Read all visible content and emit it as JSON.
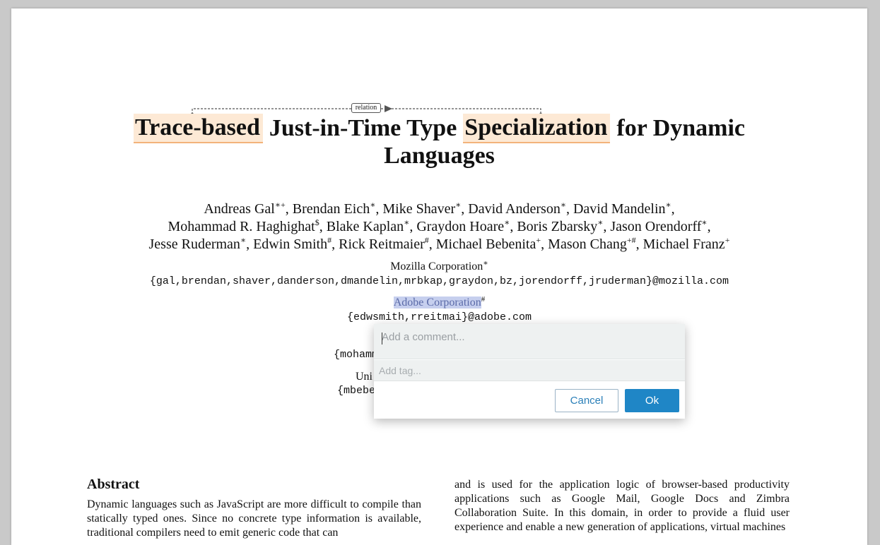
{
  "paper": {
    "title_part1": "Trace-based",
    "title_part2": "Just-in-Time Type",
    "title_part3": "Specialization",
    "title_part4": "for Dynamic",
    "title_line2": "Languages",
    "relation_label": "relation",
    "authors": {
      "line1": [
        {
          "name": "Andreas Gal",
          "mark": "∗+"
        },
        {
          "name": ", Brendan Eich",
          "mark": "∗"
        },
        {
          "name": ", Mike Shaver",
          "mark": "∗"
        },
        {
          "name": ", David Anderson",
          "mark": "∗"
        },
        {
          "name": ", David Mandelin",
          "mark": "∗"
        },
        {
          "name": ",",
          "mark": ""
        }
      ],
      "line2": [
        {
          "name": "Mohammad R. Haghighat",
          "mark": "$"
        },
        {
          "name": ", Blake Kaplan",
          "mark": "∗"
        },
        {
          "name": ", Graydon Hoare",
          "mark": "∗"
        },
        {
          "name": ", Boris Zbarsky",
          "mark": "∗"
        },
        {
          "name": ", Jason Orendorff",
          "mark": "∗"
        },
        {
          "name": ",",
          "mark": ""
        }
      ],
      "line3": [
        {
          "name": "Jesse Ruderman",
          "mark": "∗"
        },
        {
          "name": ", Edwin Smith",
          "mark": "#"
        },
        {
          "name": ", Rick Reitmaier",
          "mark": "#"
        },
        {
          "name": ", Michael Bebenita",
          "mark": "+"
        },
        {
          "name": ", Mason Chang",
          "mark": "+#"
        },
        {
          "name": ", Michael Franz",
          "mark": "+"
        }
      ]
    },
    "affiliation1": {
      "name": "Mozilla Corporation",
      "mark": "∗"
    },
    "emails1": "{gal,brendan,shaver,danderson,dmandelin,mrbkap,graydon,bz,jorendorff,jruderman}@mozilla.com",
    "affiliation2": {
      "name": "Adobe Corporation",
      "mark": "#"
    },
    "emails2": "{edwsmith,rreitmai}@adobe.com",
    "emails3_partial": "{mohamm",
    "affiliation4_partial": "Uni",
    "emails4_partial": "{mbebe",
    "abstract_heading": "Abstract",
    "abstract_left": "Dynamic languages such as JavaScript are more difficult to compile than statically typed ones. Since no concrete type information is available, traditional compilers need to emit generic code that can",
    "abstract_right": "and is used for the application logic of browser-based productivity applications such as Google Mail, Google Docs and Zimbra Collaboration Suite. In this domain, in order to provide a fluid user experience and enable a new generation of applications, virtual machines"
  },
  "popup": {
    "comment_placeholder": "Add a comment...",
    "comment_value": "",
    "tag_placeholder": "Add tag...",
    "tag_value": "",
    "cancel_label": "Cancel",
    "ok_label": "Ok"
  },
  "colors": {
    "highlight_entity": "#fde9d5",
    "highlight_underline": "#f3b37b",
    "selection": "#c6cfee",
    "ok_button": "#1f86c6",
    "popup_field": "#eef1f1"
  }
}
